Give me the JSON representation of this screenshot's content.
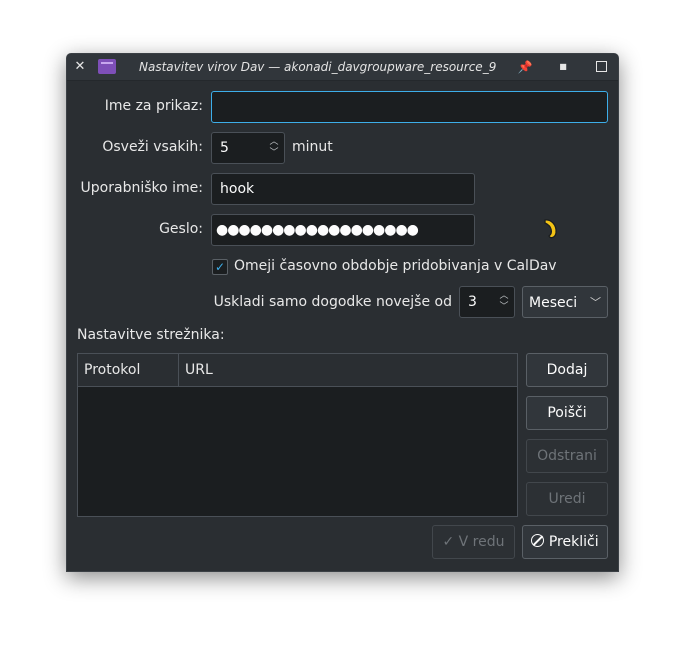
{
  "window": {
    "title": "Nastavitev virov Dav — akonadi_davgroupware_resource_9"
  },
  "form": {
    "display_name_label": "Ime za prikaz:",
    "display_name_value": "",
    "refresh_label": "Osveži vsakih:",
    "refresh_value": "5",
    "refresh_unit": "minut",
    "username_label": "Uporabniško ime:",
    "username_value": "hook",
    "password_label": "Geslo:",
    "password_value": "●●●●●●●●●●●●●●●●●●",
    "limit_checkbox_label": "Omeji časovno obdobje pridobivanja v CalDav",
    "limit_checked": true,
    "limit_label": "Uskladi samo dogodke novejše od",
    "limit_value": "3",
    "limit_unit": "Meseci"
  },
  "server": {
    "section_label": "Nastavitve strežnika:",
    "columns": [
      "Protokol",
      "URL"
    ],
    "rows": [],
    "add_label": "Dodaj",
    "search_label": "Poišči",
    "remove_label": "Odstrani",
    "edit_label": "Uredi"
  },
  "footer": {
    "ok_label": "V redu",
    "cancel_label": "Prekliči"
  },
  "colors": {
    "accent": "#3daee9",
    "window_bg": "#2a2e32",
    "field_bg": "#1b1e20",
    "app_icon": "#7e4fb8",
    "cursor": "#f3c315"
  }
}
